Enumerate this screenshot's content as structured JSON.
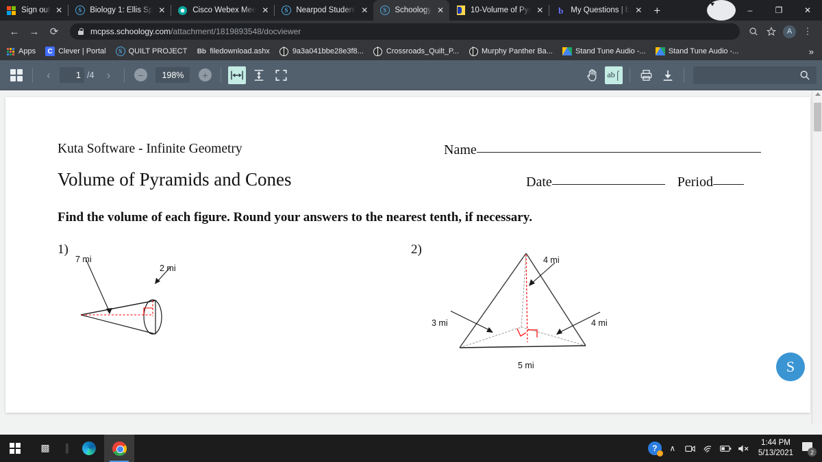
{
  "browser": {
    "tabs": [
      {
        "title": "Sign out",
        "icon": "microsoft-icon",
        "active": false
      },
      {
        "title": "Biology 1: Ellis Sp",
        "icon": "schoology-icon",
        "active": false
      },
      {
        "title": "Cisco Webex Mee",
        "icon": "webex-icon",
        "active": false
      },
      {
        "title": "Nearpod Student",
        "icon": "schoology-icon",
        "active": false
      },
      {
        "title": "Schoology",
        "icon": "schoology-icon",
        "active": true
      },
      {
        "title": "10-Volume of Pyr",
        "icon": "pdf-icon",
        "active": false
      },
      {
        "title": "My Questions | b",
        "icon": "brainly-icon",
        "active": false
      }
    ],
    "new_tab_label": "+",
    "close_label": "✕",
    "window_controls": {
      "minimize": "–",
      "maximize": "❐",
      "close": "✕"
    },
    "url": {
      "domain": "mcpss.schoology.com",
      "path": "/attachment/1819893548/docviewer"
    },
    "nav": {
      "back": "←",
      "forward": "→",
      "reload": "⟳"
    },
    "profile_initial": "A",
    "menu_label": "⋮",
    "bookmarks": [
      {
        "label": "Apps",
        "icon": "apps-grid-icon"
      },
      {
        "label": "Clever | Portal",
        "icon": "clever-icon"
      },
      {
        "label": "QUILT PROJECT",
        "icon": "schoology-icon"
      },
      {
        "label": "filedownload.ashx",
        "icon": "blackboard-icon"
      },
      {
        "label": "9a3a041bbe28e3f8...",
        "icon": "globe-icon"
      },
      {
        "label": "Crossroads_Quilt_P...",
        "icon": "globe-icon"
      },
      {
        "label": "Murphy Panther Ba...",
        "icon": "globe-icon"
      },
      {
        "label": "Stand Tune Audio -...",
        "icon": "google-drive-icon"
      },
      {
        "label": "Stand Tune Audio -...",
        "icon": "google-drive-icon"
      }
    ],
    "bookmarks_overflow": "»"
  },
  "docviewer": {
    "thumbnails_label": "thumbnails",
    "prev_page": "‹",
    "next_page": "›",
    "current_page": "1",
    "total_pages": "/4",
    "zoom_out": "−",
    "zoom_level": "198%",
    "zoom_in": "+",
    "fit_width_selected": true,
    "text_select_selected": true,
    "text_select_label": "ab",
    "search_placeholder": ""
  },
  "worksheet": {
    "publisher": "Kuta Software - Infinite Geometry",
    "title": "Volume of Pyramids and Cones",
    "name_label": "Name",
    "date_label": "Date",
    "period_label": "Period",
    "instructions": "Find the volume of each figure.  Round your answers to the nearest tenth, if necessary.",
    "problems": [
      {
        "number": "1)",
        "shape": "cone",
        "labels": [
          {
            "text": "7 mi",
            "meaning": "height"
          },
          {
            "text": "2 mi",
            "meaning": "radius"
          }
        ]
      },
      {
        "number": "2)",
        "shape": "triangular-pyramid",
        "labels": [
          {
            "text": "4 mi",
            "meaning": "pyramid-height"
          },
          {
            "text": "3 mi",
            "meaning": "base-triangle-height"
          },
          {
            "text": "4 mi",
            "meaning": "base-edge"
          },
          {
            "text": "5 mi",
            "meaning": "base-width"
          }
        ]
      }
    ]
  },
  "schoology_fab": "S",
  "taskbar": {
    "start_label": "start",
    "task_view_label": "task-view",
    "apps": [
      "edge",
      "chrome"
    ],
    "tray": {
      "help_label": "?",
      "chevron": "∧",
      "camera": "▣",
      "wifi": "wifi",
      "battery": "battery",
      "volume": "✕",
      "time": "1:44 PM",
      "date": "5/13/2021",
      "notification_count": "2"
    }
  },
  "colors": {
    "chrome_dark": "#202124",
    "chrome_toolbar": "#35363a",
    "docviewer_toolbar": "#52606e",
    "selected_tool": "#c4ece4",
    "schoology_blue": "#3b95d3",
    "figure_accent": "#ff0000"
  }
}
